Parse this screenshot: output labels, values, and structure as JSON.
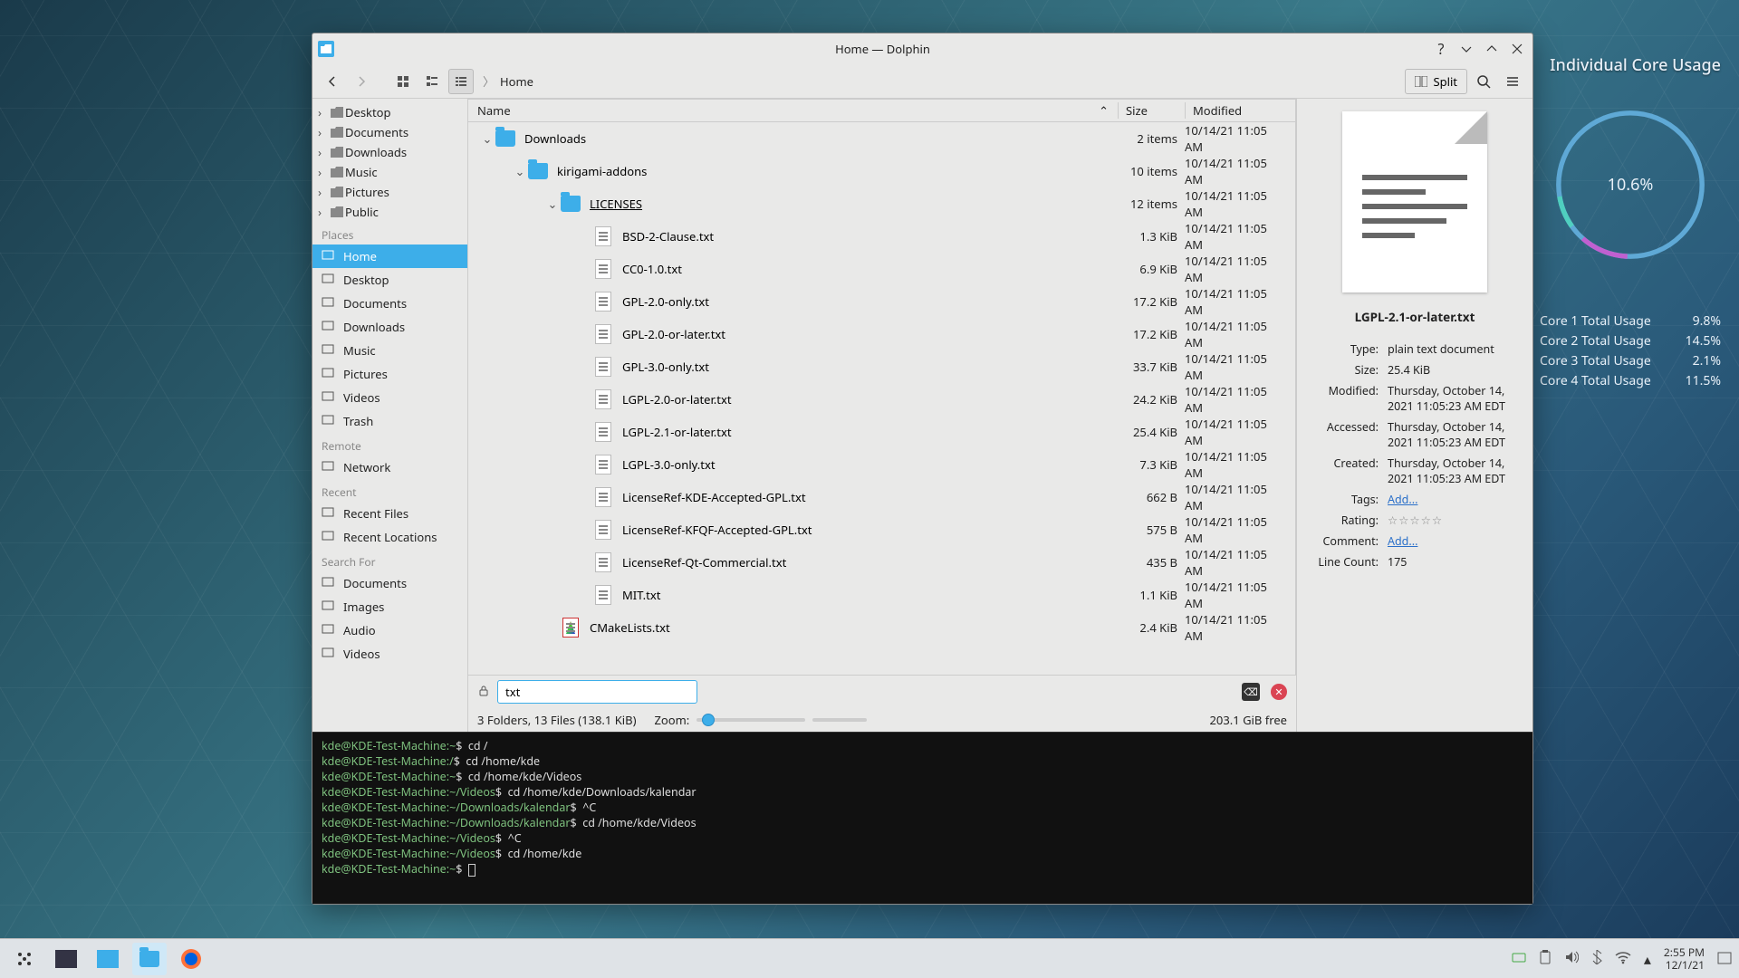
{
  "widget": {
    "title": "Individual Core Usage",
    "ring_pct": "10.6%",
    "cores": [
      {
        "label": "Core 1 Total Usage",
        "val": "9.8%"
      },
      {
        "label": "Core 2 Total Usage",
        "val": "14.5%"
      },
      {
        "label": "Core 3 Total Usage",
        "val": "2.1%"
      },
      {
        "label": "Core 4 Total Usage",
        "val": "11.5%"
      }
    ]
  },
  "window": {
    "title": "Home — Dolphin",
    "breadcrumb": "Home",
    "split_label": "Split",
    "columns": {
      "name": "Name",
      "size": "Size",
      "modified": "Modified"
    },
    "filter_value": "txt",
    "status_summary": "3 Folders, 13 Files (138.1 KiB)",
    "zoom_label": "Zoom:",
    "free_space": "203.1 GiB free"
  },
  "sidebar": {
    "tree": [
      "Desktop",
      "Documents",
      "Downloads",
      "Music",
      "Pictures",
      "Public"
    ],
    "places_head": "Places",
    "places": [
      "Home",
      "Desktop",
      "Documents",
      "Downloads",
      "Music",
      "Pictures",
      "Videos",
      "Trash"
    ],
    "remote_head": "Remote",
    "remote": [
      "Network"
    ],
    "recent_head": "Recent",
    "recent": [
      "Recent Files",
      "Recent Locations"
    ],
    "search_head": "Search For",
    "search": [
      "Documents",
      "Images",
      "Audio",
      "Videos"
    ]
  },
  "files": [
    {
      "depth": 0,
      "exp": "open",
      "type": "folder",
      "name": "Downloads",
      "size": "2 items",
      "mod": "10/14/21 11:05 AM"
    },
    {
      "depth": 1,
      "exp": "open",
      "type": "folder",
      "name": "kirigami-addons",
      "size": "10 items",
      "mod": "10/14/21 11:05 AM"
    },
    {
      "depth": 2,
      "exp": "open",
      "type": "folder",
      "name": "LICENSES",
      "underline": true,
      "size": "12 items",
      "mod": "10/14/21 11:05 AM"
    },
    {
      "depth": 3,
      "exp": "none",
      "type": "txt",
      "name": "BSD-2-Clause.txt",
      "size": "1.3 KiB",
      "mod": "10/14/21 11:05 AM"
    },
    {
      "depth": 3,
      "exp": "none",
      "type": "txt",
      "name": "CC0-1.0.txt",
      "size": "6.9 KiB",
      "mod": "10/14/21 11:05 AM"
    },
    {
      "depth": 3,
      "exp": "none",
      "type": "txt",
      "name": "GPL-2.0-only.txt",
      "size": "17.2 KiB",
      "mod": "10/14/21 11:05 AM"
    },
    {
      "depth": 3,
      "exp": "none",
      "type": "txt",
      "name": "GPL-2.0-or-later.txt",
      "size": "17.2 KiB",
      "mod": "10/14/21 11:05 AM"
    },
    {
      "depth": 3,
      "exp": "none",
      "type": "txt",
      "name": "GPL-3.0-only.txt",
      "size": "33.7 KiB",
      "mod": "10/14/21 11:05 AM"
    },
    {
      "depth": 3,
      "exp": "none",
      "type": "txt",
      "name": "LGPL-2.0-or-later.txt",
      "size": "24.2 KiB",
      "mod": "10/14/21 11:05 AM"
    },
    {
      "depth": 3,
      "exp": "none",
      "type": "txt",
      "name": "LGPL-2.1-or-later.txt",
      "size": "25.4 KiB",
      "mod": "10/14/21 11:05 AM"
    },
    {
      "depth": 3,
      "exp": "none",
      "type": "txt",
      "name": "LGPL-3.0-only.txt",
      "size": "7.3 KiB",
      "mod": "10/14/21 11:05 AM"
    },
    {
      "depth": 3,
      "exp": "none",
      "type": "txt",
      "name": "LicenseRef-KDE-Accepted-GPL.txt",
      "size": "662 B",
      "mod": "10/14/21 11:05 AM"
    },
    {
      "depth": 3,
      "exp": "none",
      "type": "txt",
      "name": "LicenseRef-KFQF-Accepted-GPL.txt",
      "size": "575 B",
      "mod": "10/14/21 11:05 AM"
    },
    {
      "depth": 3,
      "exp": "none",
      "type": "txt",
      "name": "LicenseRef-Qt-Commercial.txt",
      "size": "435 B",
      "mod": "10/14/21 11:05 AM"
    },
    {
      "depth": 3,
      "exp": "none",
      "type": "txt",
      "name": "MIT.txt",
      "size": "1.1 KiB",
      "mod": "10/14/21 11:05 AM"
    },
    {
      "depth": 2,
      "exp": "none",
      "type": "cmake",
      "name": "CMakeLists.txt",
      "size": "2.4 KiB",
      "mod": "10/14/21 11:05 AM"
    }
  ],
  "info": {
    "filename": "LGPL-2.1-or-later.txt",
    "rows": [
      {
        "k": "Type:",
        "v": "plain text document"
      },
      {
        "k": "Size:",
        "v": "25.4 KiB"
      },
      {
        "k": "Modified:",
        "v": "Thursday, October 14, 2021 11:05:23 AM EDT"
      },
      {
        "k": "Accessed:",
        "v": "Thursday, October 14, 2021 11:05:23 AM EDT"
      },
      {
        "k": "Created:",
        "v": "Thursday, October 14, 2021 11:05:23 AM EDT"
      },
      {
        "k": "Tags:",
        "v": "Add...",
        "link": true
      },
      {
        "k": "Rating:",
        "stars": true
      },
      {
        "k": "Comment:",
        "v": "Add...",
        "link": true
      },
      {
        "k": "Line Count:",
        "v": "175"
      }
    ]
  },
  "terminal": {
    "user": "kde@KDE-Test-Machine",
    "lines": [
      {
        "path": "~",
        "cmd": "cd /"
      },
      {
        "path": "/",
        "cmd": "cd /home/kde"
      },
      {
        "path": "~",
        "cmd": "cd /home/kde/Videos"
      },
      {
        "path": "~/Videos",
        "cmd": "cd /home/kde/Downloads/kalendar"
      },
      {
        "path": "~/Downloads/kalendar",
        "cmd": "^C"
      },
      {
        "path": "~/Downloads/kalendar",
        "cmd": "cd /home/kde/Videos"
      },
      {
        "path": "~/Videos",
        "cmd": "^C"
      },
      {
        "path": "~/Videos",
        "cmd": "cd /home/kde"
      },
      {
        "path": "~",
        "cmd": "",
        "cursor": true
      }
    ]
  },
  "clock": {
    "time": "2:55 PM",
    "date": "12/1/21"
  }
}
